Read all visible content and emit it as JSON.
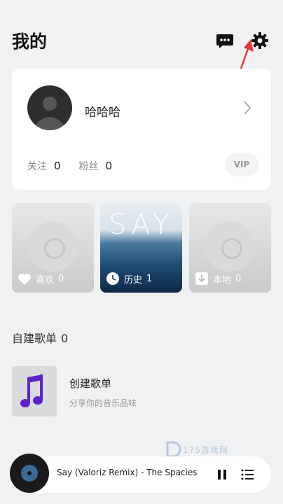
{
  "header": {
    "title": "我的",
    "icons": [
      "message-icon",
      "settings-gear-icon"
    ]
  },
  "profile": {
    "username": "哈哈哈",
    "following_label": "关注",
    "following_count": "0",
    "fans_label": "粉丝",
    "fans_count": "0",
    "vip_label": "VIP"
  },
  "tiles": [
    {
      "label": "喜欢",
      "count": "0",
      "icon": "heart-icon"
    },
    {
      "label": "历史",
      "count": "1",
      "icon": "clock-icon",
      "cover_text": "SAY"
    },
    {
      "label": "本地",
      "count": "0",
      "icon": "download-icon"
    }
  ],
  "playlists_section": {
    "title": "自建歌单",
    "count": "0"
  },
  "create_playlist": {
    "title": "创建歌单",
    "subtitle": "分享你的音乐品味",
    "icon": "music-note-icon"
  },
  "watermark": {
    "text": "175游戏网"
  },
  "player": {
    "song_title": "Say (Valoriz Remix) - The Spacies",
    "icons": [
      "pause-icon",
      "playlist-queue-icon"
    ]
  },
  "colors": {
    "background": "#f0f1f3",
    "card": "#ffffff",
    "accent_purple": "#5a22c8",
    "annotation_red": "#e0393e"
  }
}
